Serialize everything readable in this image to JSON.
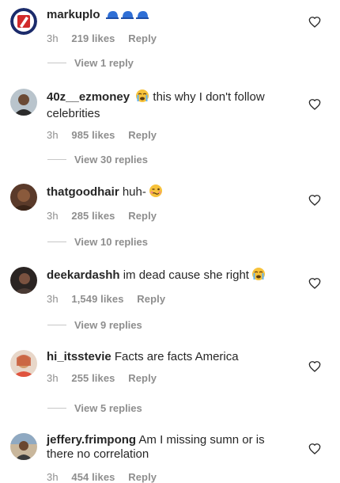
{
  "comments": [
    {
      "username": "markuplo",
      "text": "",
      "emoji": [
        "blue-cap",
        "blue-cap",
        "blue-cap"
      ],
      "time": "3h",
      "likes": "219 likes",
      "reply": "Reply",
      "view_replies": "View 1 reply"
    },
    {
      "username": "40z__ezmoney",
      "text": "this why I don't follow celebrities",
      "emoji": [
        "loudly-crying-face"
      ],
      "time": "3h",
      "likes": "985 likes",
      "reply": "Reply",
      "view_replies": "View 30 replies"
    },
    {
      "username": "thatgoodhair",
      "text": "huh-",
      "emoji": [
        "woozy-face"
      ],
      "time": "3h",
      "likes": "285 likes",
      "reply": "Reply",
      "view_replies": "View 10 replies"
    },
    {
      "username": "deekardashh",
      "text": "im dead cause she right",
      "emoji": [
        "loudly-crying-face"
      ],
      "time": "3h",
      "likes": "1,549 likes",
      "reply": "Reply",
      "view_replies": "View 9 replies"
    },
    {
      "username": "hi_itsstevie",
      "text": "Facts are facts America",
      "emoji": [],
      "time": "3h",
      "likes": "255 likes",
      "reply": "Reply",
      "view_replies": "View 5 replies"
    },
    {
      "username": "jeffery.frimpong",
      "text": "Am I missing sumn or is there no correlation",
      "emoji": [],
      "time": "3h",
      "likes": "454 likes",
      "reply": "Reply",
      "view_replies": ""
    }
  ],
  "icons": {
    "like": "heart-outline-icon"
  },
  "colors": {
    "text": "#262626",
    "secondary": "#8e8e8e",
    "divider": "#c7c7c7"
  }
}
